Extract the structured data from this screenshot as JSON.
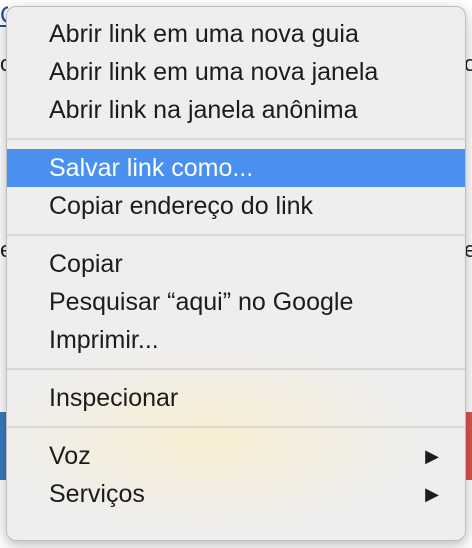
{
  "background": {
    "link_fragment": "C",
    "left_fragments": [
      "o",
      "e"
    ],
    "right_fragments": [
      "o",
      "e"
    ]
  },
  "menu": {
    "groups": [
      {
        "items": [
          {
            "label": "Abrir link em uma nova guia"
          },
          {
            "label": "Abrir link em uma nova janela"
          },
          {
            "label": "Abrir link na janela anônima"
          }
        ]
      },
      {
        "items": [
          {
            "label": "Salvar link como...",
            "highlighted": true
          },
          {
            "label": "Copiar endereço do link"
          }
        ]
      },
      {
        "items": [
          {
            "label": "Copiar"
          },
          {
            "label": "Pesquisar “aqui” no Google"
          },
          {
            "label": "Imprimir..."
          }
        ]
      },
      {
        "items": [
          {
            "label": "Inspecionar"
          }
        ]
      },
      {
        "items": [
          {
            "label": "Voz",
            "submenu": true,
            "icon": "submenu-arrow-icon"
          },
          {
            "label": "Serviços",
            "submenu": true,
            "icon": "submenu-arrow-icon"
          }
        ]
      }
    ]
  },
  "colors": {
    "highlight": "#4a90f0",
    "menu_background": "#efeeed",
    "text": "#1c1c1c"
  }
}
